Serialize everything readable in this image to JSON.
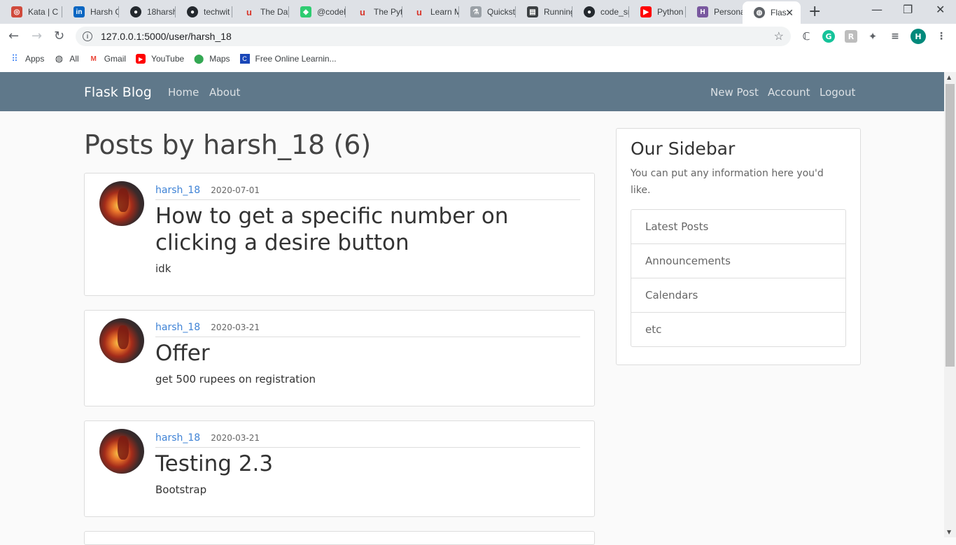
{
  "browser": {
    "tabs": [
      {
        "title": "Kata | C",
        "icon": "codewars-icon",
        "color": "#d04a3c"
      },
      {
        "title": "Harsh G",
        "icon": "linkedin-icon",
        "color": "#0a66c2"
      },
      {
        "title": "18harsh",
        "icon": "github-icon",
        "color": "#24292e"
      },
      {
        "title": "techwit",
        "icon": "github-icon",
        "color": "#24292e"
      },
      {
        "title": "The Dat",
        "icon": "udemy-icon",
        "color": "#d8352a"
      },
      {
        "title": "@codeh",
        "icon": "codechef-icon",
        "color": "#2ecc71"
      },
      {
        "title": "The Pyt",
        "icon": "udemy-icon",
        "color": "#d8352a"
      },
      {
        "title": "Learn M",
        "icon": "udemy-icon",
        "color": "#d8352a"
      },
      {
        "title": "Quickst",
        "icon": "flask-icon",
        "color": "#5f6368"
      },
      {
        "title": "Running",
        "icon": "doc-icon",
        "color": "#3c4043"
      },
      {
        "title": "code_sr",
        "icon": "github-icon",
        "color": "#24292e"
      },
      {
        "title": "Python",
        "icon": "youtube-icon",
        "color": "#ff0000"
      },
      {
        "title": "Persona",
        "icon": "heroku-icon",
        "color": "#79589f"
      },
      {
        "title": "Flas",
        "icon": "globe-icon",
        "color": "#5f6368",
        "active": true
      }
    ],
    "url": "127.0.0.1:5000/user/harsh_18",
    "profile_initial": "H",
    "bookmarks": [
      {
        "label": "Apps",
        "icon": "apps-grid-icon"
      },
      {
        "label": "All",
        "icon": "globe-icon"
      },
      {
        "label": "Gmail",
        "icon": "gmail-icon"
      },
      {
        "label": "YouTube",
        "icon": "youtube-icon"
      },
      {
        "label": "Maps",
        "icon": "maps-icon"
      },
      {
        "label": "Free Online Learnin...",
        "icon": "learning-icon"
      }
    ]
  },
  "navbar": {
    "brand": "Flask Blog",
    "left_links": [
      "Home",
      "About"
    ],
    "right_links": [
      "New Post",
      "Account",
      "Logout"
    ],
    "bg_color": "#5f788a"
  },
  "page": {
    "heading": "Posts by harsh_18 (6)"
  },
  "posts": [
    {
      "author": "harsh_18",
      "date": "2020-07-01",
      "title": "How to get a specific number on clicking a desire button",
      "content": "idk"
    },
    {
      "author": "harsh_18",
      "date": "2020-03-21",
      "title": "Offer",
      "content": "get 500 rupees on registration"
    },
    {
      "author": "harsh_18",
      "date": "2020-03-21",
      "title": "Testing 2.3",
      "content": "Bootstrap"
    }
  ],
  "sidebar": {
    "title": "Our Sidebar",
    "text": "You can put any information here you'd like.",
    "items": [
      "Latest Posts",
      "Announcements",
      "Calendars",
      "etc"
    ]
  },
  "colors": {
    "link": "#3f83d6"
  }
}
